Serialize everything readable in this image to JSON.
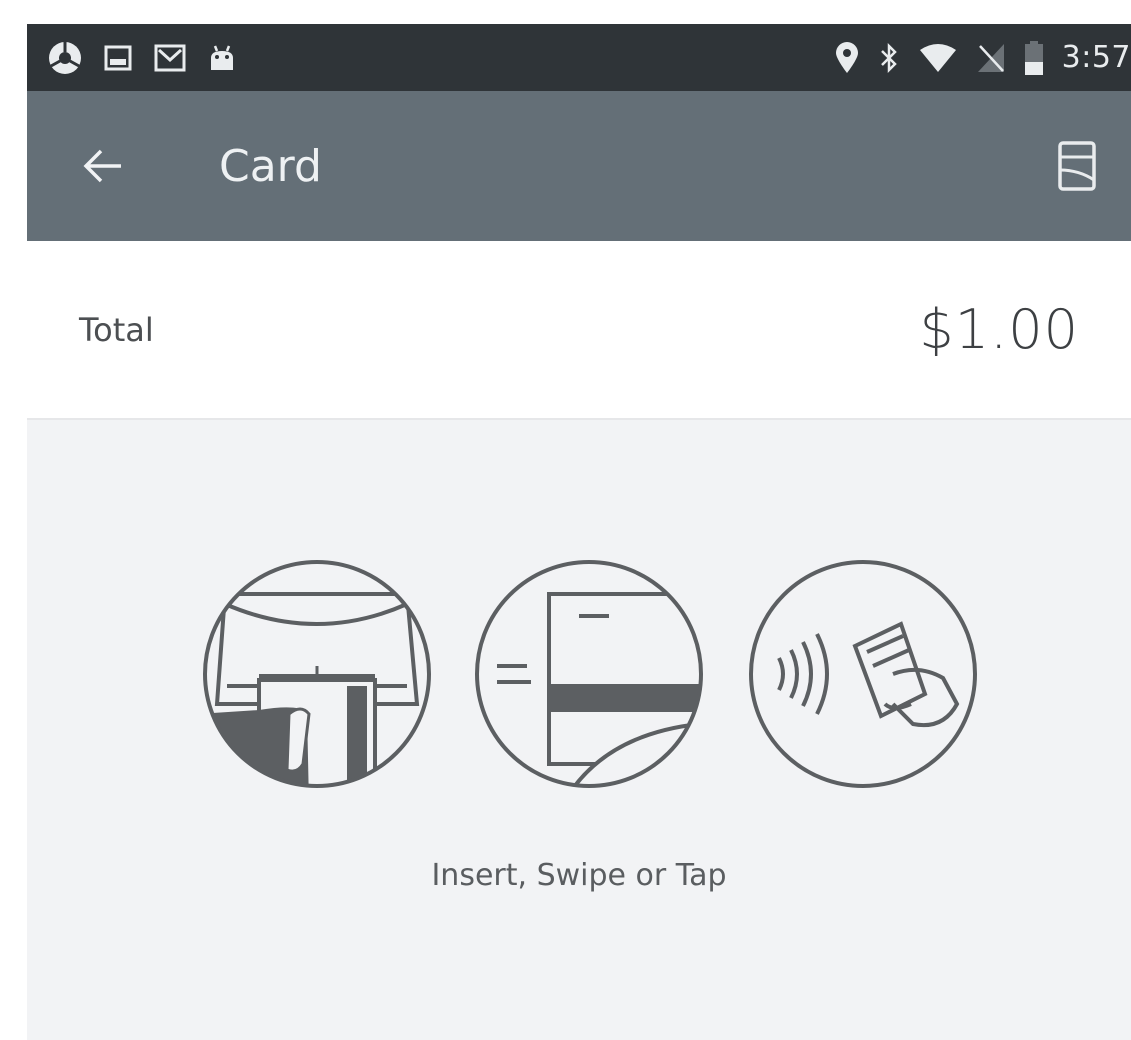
{
  "status_bar": {
    "time": "3:57",
    "left_icons": [
      "chrome-icon",
      "image-icon",
      "gmail-icon",
      "android-icon"
    ],
    "right_icons": [
      "location-icon",
      "bluetooth-icon",
      "wifi-icon",
      "no-sim-icon",
      "battery-icon"
    ]
  },
  "app_bar": {
    "title": "Card",
    "back_icon": "arrow-left-icon",
    "action_icon": "receipt-icon",
    "background": "#646f77"
  },
  "total": {
    "label": "Total",
    "amount": "$1.00"
  },
  "payment": {
    "methods": [
      "insert-card-icon",
      "swipe-card-icon",
      "tap-card-icon"
    ],
    "prompt": "Insert, Swipe or Tap"
  },
  "colors": {
    "status_bar": "#2f3438",
    "background": "#f2f3f5",
    "icon_stroke": "#5c5f62"
  }
}
